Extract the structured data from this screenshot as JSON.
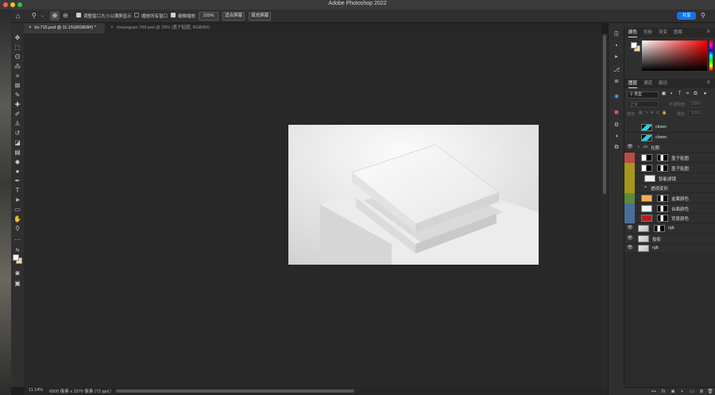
{
  "app": {
    "title": "Adobe Photoshop 2022"
  },
  "options_bar": {
    "resize_windows": "调整窗口大小以满屏显示",
    "zoom_all_windows": "缩放所有窗口",
    "scrubby_zoom": "细微缩放",
    "zoom_level": "100%",
    "fit_screen": "适合屏幕",
    "fill_screen": "填充屏幕",
    "share": "共享"
  },
  "doc_tabs": [
    {
      "label": "bv.715.psd @ 11.1%(RGB/8#) *",
      "active": true
    },
    {
      "label": "chayeguan.708.psd @ 25% (盖子贴图, RGB/8#)",
      "active": false
    }
  ],
  "status_bar": {
    "zoom": "11.14%",
    "doc_info": "6000 像素 x 3376 像素 (72 ppi)",
    "arrow": "〉"
  },
  "color_panel": {
    "tabs": [
      "颜色",
      "色板",
      "渐变",
      "图案"
    ],
    "fg_color": "#ffffff",
    "bg_color": "#f2d9a6"
  },
  "layers_panel": {
    "tabs": [
      "图层",
      "通道",
      "路径"
    ],
    "search_placeholder": "类型",
    "blend_mode": "正常",
    "opacity_label": "不透明度:",
    "opacity_value": "100%",
    "lock_label": "锁定:",
    "fill_label": "填充:",
    "fill_value": "100%",
    "layers": [
      {
        "name": "clown",
        "eye": false,
        "color": "",
        "thumb": "cyan",
        "indent": 1
      },
      {
        "name": "clown",
        "eye": false,
        "color": "",
        "thumb": "cyan",
        "indent": 1
      },
      {
        "name": "光照",
        "eye": true,
        "color": "",
        "thumb": "folder",
        "indent": 0
      },
      {
        "name": "盖子贴图",
        "eye": false,
        "color": "#b94a4a",
        "thumb": "mask",
        "indent": 1
      },
      {
        "name": "盖子贴图",
        "eye": false,
        "color": "#a8961c",
        "thumb": "mask",
        "indent": 1
      },
      {
        "name": "智能滤镜",
        "eye": false,
        "color": "#a8961c",
        "thumb": "filter",
        "indent": 2
      },
      {
        "name": "透视变形",
        "eye": false,
        "color": "#a8961c",
        "thumb": "none",
        "indent": 2
      },
      {
        "name": "金属颜色",
        "eye": false,
        "color": "#5a8a3a",
        "thumb": "fill-orange",
        "indent": 1
      },
      {
        "name": "台面颜色",
        "eye": false,
        "color": "#4a6e9a",
        "thumb": "fill-white",
        "indent": 1
      },
      {
        "name": "背景颜色",
        "eye": false,
        "color": "#4a6e9a",
        "thumb": "fill-red",
        "indent": 1
      },
      {
        "name": "rgb",
        "eye": true,
        "color": "",
        "thumb": "photo",
        "indent": 0
      },
      {
        "name": "投影",
        "eye": true,
        "color": "",
        "thumb": "photo",
        "indent": 0
      },
      {
        "name": "rgb",
        "eye": true,
        "color": "",
        "thumb": "photo",
        "indent": 0
      }
    ]
  },
  "footer": {
    "fx": "fx"
  }
}
